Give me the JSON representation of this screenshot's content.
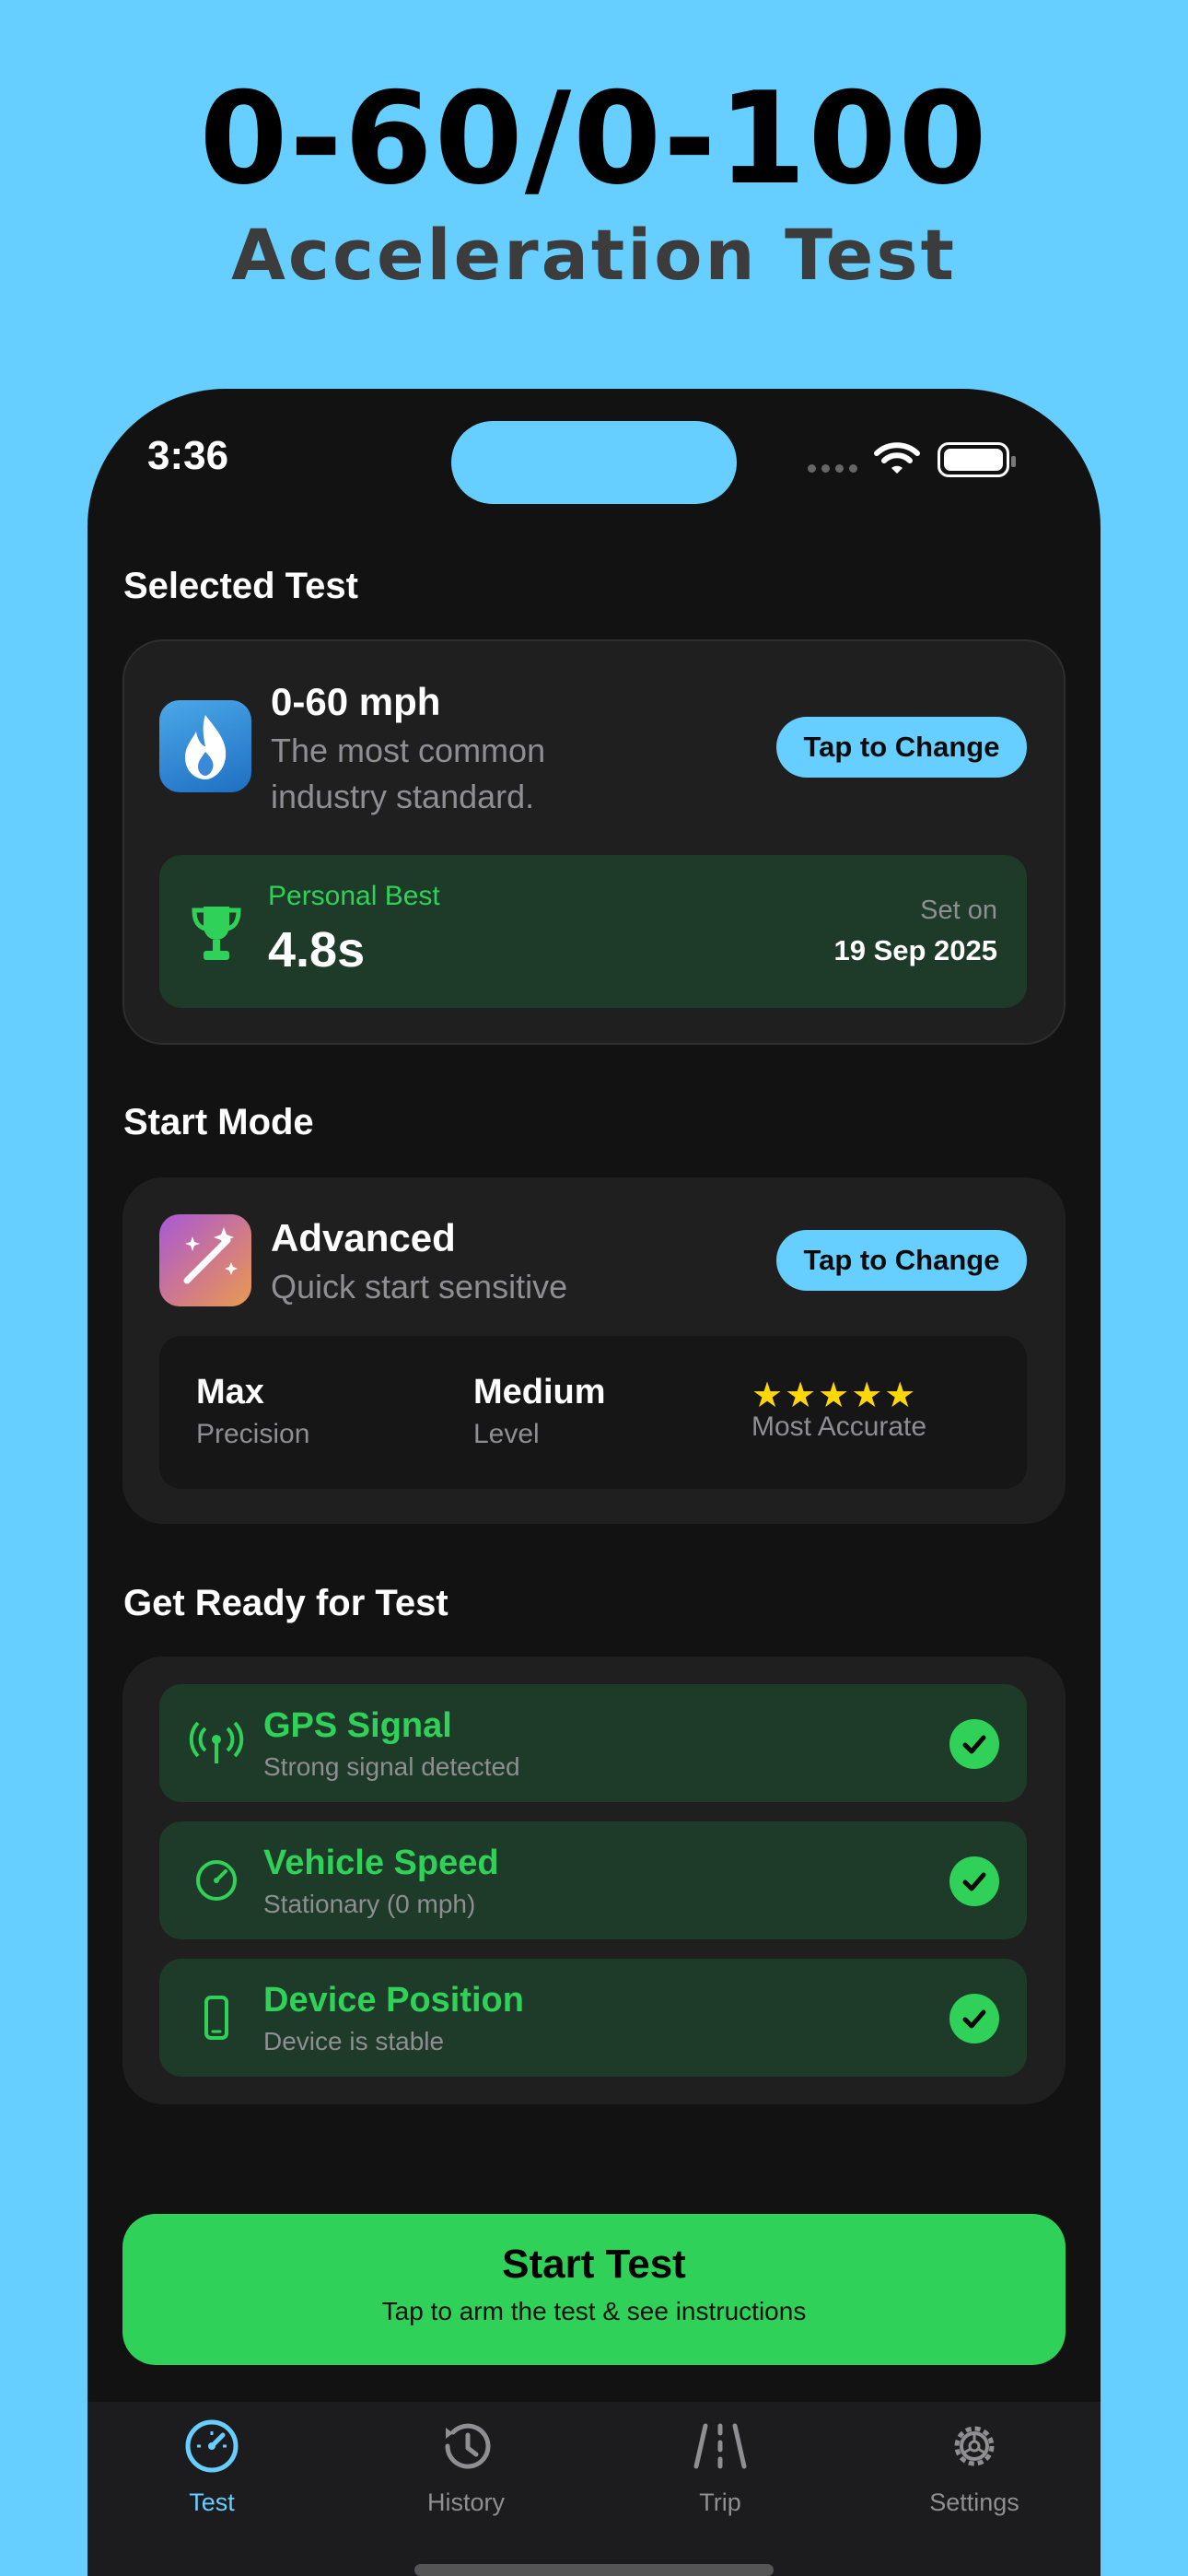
{
  "hero": {
    "title": "0-60/0-100",
    "subtitle": "Acceleration Test"
  },
  "status_bar": {
    "time": "3:36"
  },
  "selected_test": {
    "section_title": "Selected Test",
    "name": "0-60 mph",
    "description_line1": "The most common",
    "description_line2": "industry standard.",
    "change_label": "Tap to Change",
    "personal_best": {
      "label": "Personal Best",
      "value": "4.8s",
      "set_on_label": "Set on",
      "date": "19 Sep 2025"
    }
  },
  "start_mode": {
    "section_title": "Start Mode",
    "name": "Advanced",
    "description": "Quick start sensitive",
    "change_label": "Tap to Change",
    "metrics": {
      "precision_value": "Max",
      "precision_label": "Precision",
      "level_value": "Medium",
      "level_label": "Level",
      "stars": "★★★★★",
      "rating": 5,
      "accuracy_label": "Most Accurate"
    }
  },
  "get_ready": {
    "section_title": "Get Ready for Test",
    "items": [
      {
        "title": "GPS Signal",
        "subtitle": "Strong signal detected",
        "icon": "antenna-icon",
        "status": "ok"
      },
      {
        "title": "Vehicle Speed",
        "subtitle": "Stationary (0 mph)",
        "icon": "speedometer-icon",
        "status": "ok"
      },
      {
        "title": "Device Position",
        "subtitle": "Device is stable",
        "icon": "phone-icon",
        "status": "ok"
      }
    ]
  },
  "start_button": {
    "title": "Start Test",
    "subtitle": "Tap to arm the test & see instructions"
  },
  "tabbar": {
    "tabs": [
      {
        "label": "Test",
        "icon": "speedometer-icon",
        "active": true
      },
      {
        "label": "History",
        "icon": "clock-history-icon",
        "active": false
      },
      {
        "label": "Trip",
        "icon": "road-icon",
        "active": false
      },
      {
        "label": "Settings",
        "icon": "gear-icon",
        "active": false
      }
    ]
  },
  "colors": {
    "background": "#66cfff",
    "phone": "#121212",
    "card": "#1f1f1f",
    "accent_blue": "#66cfff",
    "success_green": "#30d158",
    "ready_row": "#1e3a28",
    "star_yellow": "#ffd60a"
  }
}
